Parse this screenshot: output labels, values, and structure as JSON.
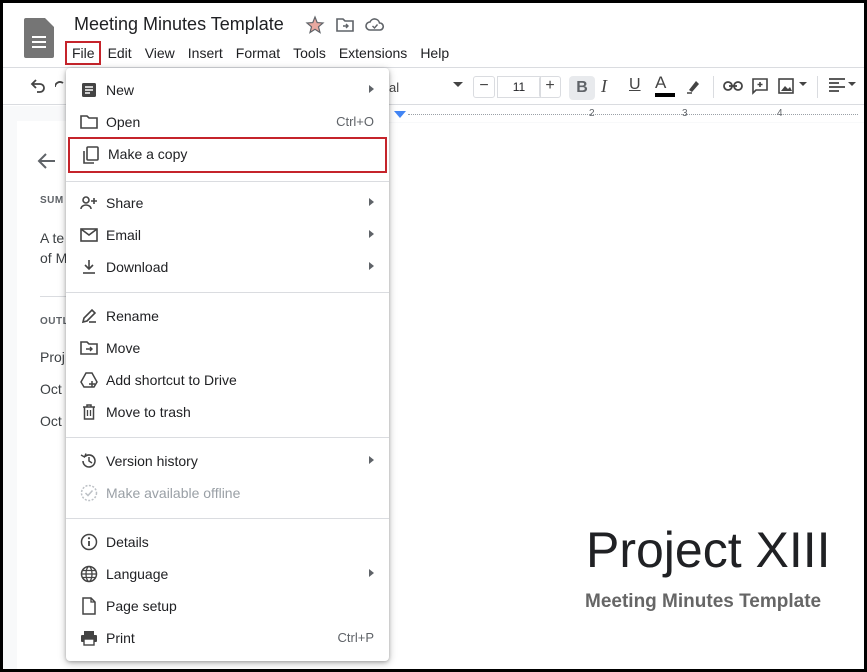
{
  "document": {
    "title": "Meeting Minutes Template",
    "big_title": "Project XIII",
    "subtitle": "Meeting Minutes Template"
  },
  "menubar": [
    "File",
    "Edit",
    "View",
    "Insert",
    "Format",
    "Tools",
    "Extensions",
    "Help"
  ],
  "toolbar": {
    "font_fragment": "al",
    "font_size": "11",
    "minus": "−",
    "plus": "+",
    "bold": "B",
    "italic": "I",
    "text_color": "A"
  },
  "ruler": [
    "2",
    "3",
    "4"
  ],
  "side_panel": {
    "summary_heading": "SUM",
    "summary_text_1": "A te",
    "summary_text_2": "of M",
    "outline_heading": "OUTL",
    "outline_1": "Proj",
    "outline_2": "Oct",
    "outline_3": "Oct"
  },
  "file_menu": {
    "new": "New",
    "open": "Open",
    "open_shortcut": "Ctrl+O",
    "make_copy": "Make a copy",
    "share": "Share",
    "email": "Email",
    "download": "Download",
    "rename": "Rename",
    "move": "Move",
    "add_shortcut": "Add shortcut to Drive",
    "move_trash": "Move to trash",
    "version_history": "Version history",
    "offline": "Make available offline",
    "details": "Details",
    "language": "Language",
    "page_setup": "Page setup",
    "print": "Print",
    "print_shortcut": "Ctrl+P"
  },
  "colors": {
    "highlight_border": "#c5242b",
    "doc_icon": "#4285f4"
  }
}
